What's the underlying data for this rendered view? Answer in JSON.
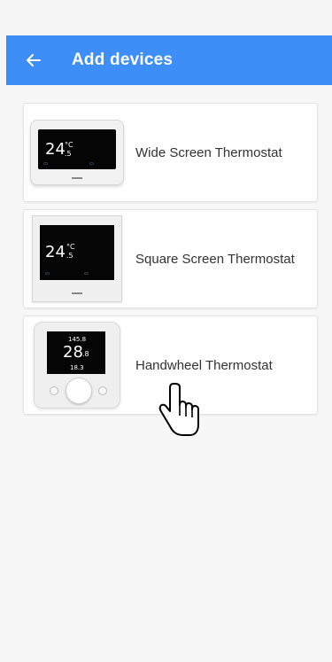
{
  "header": {
    "title": "Add devices",
    "back_icon": "back-arrow-icon",
    "color": "#3d8ff7"
  },
  "devices": [
    {
      "name": "Wide Screen Thermostat",
      "display": {
        "temp_int": "24",
        "temp_dec": ".5",
        "unit": "°C"
      }
    },
    {
      "name": "Square Screen Thermostat",
      "display": {
        "temp_int": "24",
        "temp_dec": ".5",
        "unit": "°C"
      }
    },
    {
      "name": "Handwheel Thermostat",
      "display": {
        "top": "145.8",
        "temp_int": "28",
        "temp_dec": ".8",
        "bottom": "18.3"
      }
    }
  ],
  "cursor": {
    "icon": "hand-pointer-icon"
  }
}
